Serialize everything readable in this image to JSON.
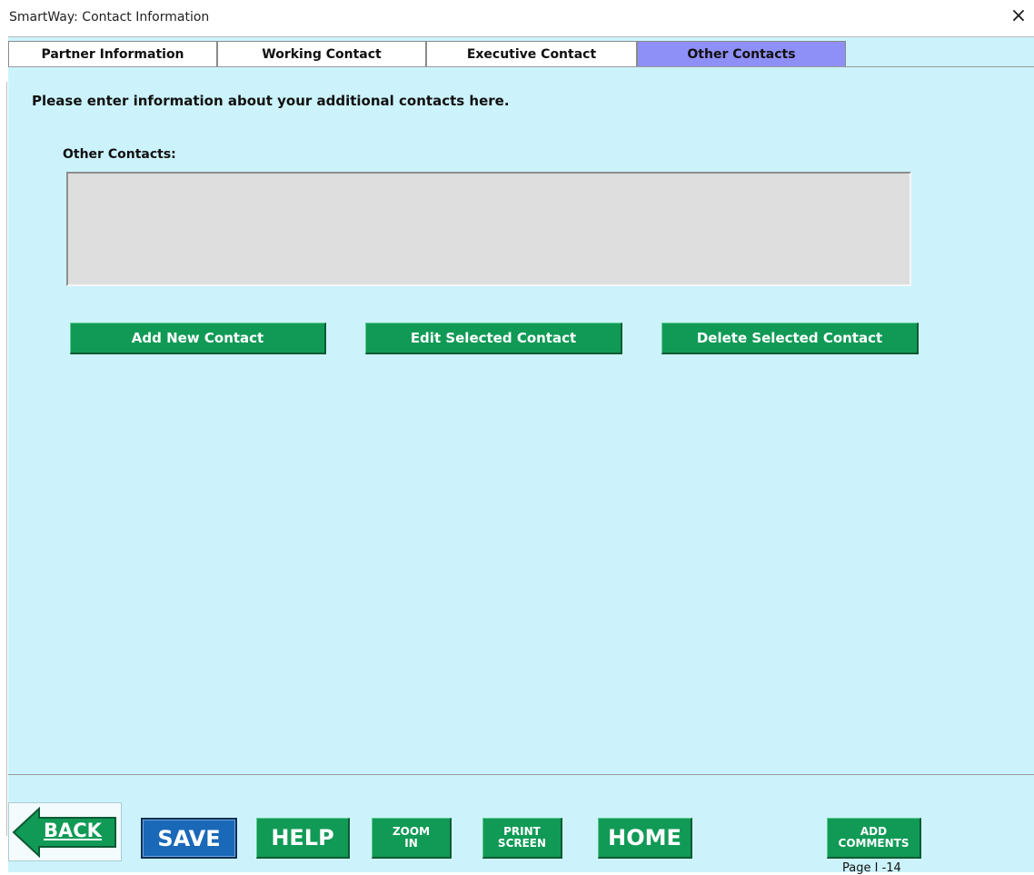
{
  "window": {
    "title": "SmartWay: Contact Information",
    "close_glyph": "×"
  },
  "tabs": [
    {
      "label": "Partner Information",
      "active": false
    },
    {
      "label": "Working Contact",
      "active": false
    },
    {
      "label": "Executive Contact",
      "active": false
    },
    {
      "label": "Other Contacts",
      "active": true
    }
  ],
  "content": {
    "instruction": "Please enter information about your additional contacts here.",
    "contacts_label": "Other Contacts:",
    "contacts_list": []
  },
  "actions": {
    "add": "Add New Contact",
    "edit": "Edit Selected Contact",
    "delete": "Delete Selected Contact"
  },
  "footer": {
    "back": "BACK",
    "save": "SAVE",
    "help": "HELP",
    "zoom_in": [
      "ZOOM",
      "IN"
    ],
    "print_screen": [
      "PRINT",
      "SCREEN"
    ],
    "home": "HOME",
    "add_comments": [
      "ADD",
      "COMMENTS"
    ],
    "page_label": "Page I -14"
  },
  "colors": {
    "background": "#ccf3fc",
    "active_tab": "#8f8ff8",
    "button_green": "#119a56",
    "save_blue": "#1a68b8",
    "list_gray": "#dedede"
  },
  "icons": {
    "close": "close-icon",
    "back": "back-arrow-icon"
  }
}
